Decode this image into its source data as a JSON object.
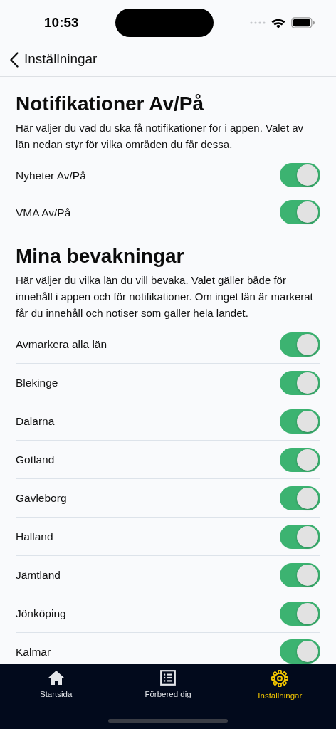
{
  "status_bar": {
    "time": "10:53"
  },
  "nav": {
    "back_label": "Inställningar"
  },
  "sections": [
    {
      "title": "Notifikationer Av/På",
      "description": "Här väljer du vad du ska få notifikationer för i appen. Valet av län nedan styr för vilka områden du får dessa.",
      "dividers": false,
      "items": [
        {
          "label": "Nyheter Av/På",
          "on": true
        },
        {
          "label": "VMA Av/På",
          "on": true
        }
      ]
    },
    {
      "title": "Mina bevakningar",
      "description": "Här väljer du vilka län du vill bevaka. Valet gäller både för innehåll i appen och för notifikationer. Om inget län är markerat får du innehåll och notiser som gäller hela landet.",
      "dividers": true,
      "items": [
        {
          "label": "Avmarkera alla län",
          "on": true
        },
        {
          "label": "Blekinge",
          "on": true
        },
        {
          "label": "Dalarna",
          "on": true
        },
        {
          "label": "Gotland",
          "on": true
        },
        {
          "label": "Gävleborg",
          "on": true
        },
        {
          "label": "Halland",
          "on": true
        },
        {
          "label": "Jämtland",
          "on": true
        },
        {
          "label": "Jönköping",
          "on": true
        },
        {
          "label": "Kalmar",
          "on": true
        }
      ]
    }
  ],
  "tab_bar": [
    {
      "label": "Startsida",
      "kind": "home",
      "selected": false
    },
    {
      "label": "Förbered dig",
      "kind": "list",
      "selected": false
    },
    {
      "label": "Inställningar",
      "kind": "settings",
      "selected": true
    }
  ]
}
